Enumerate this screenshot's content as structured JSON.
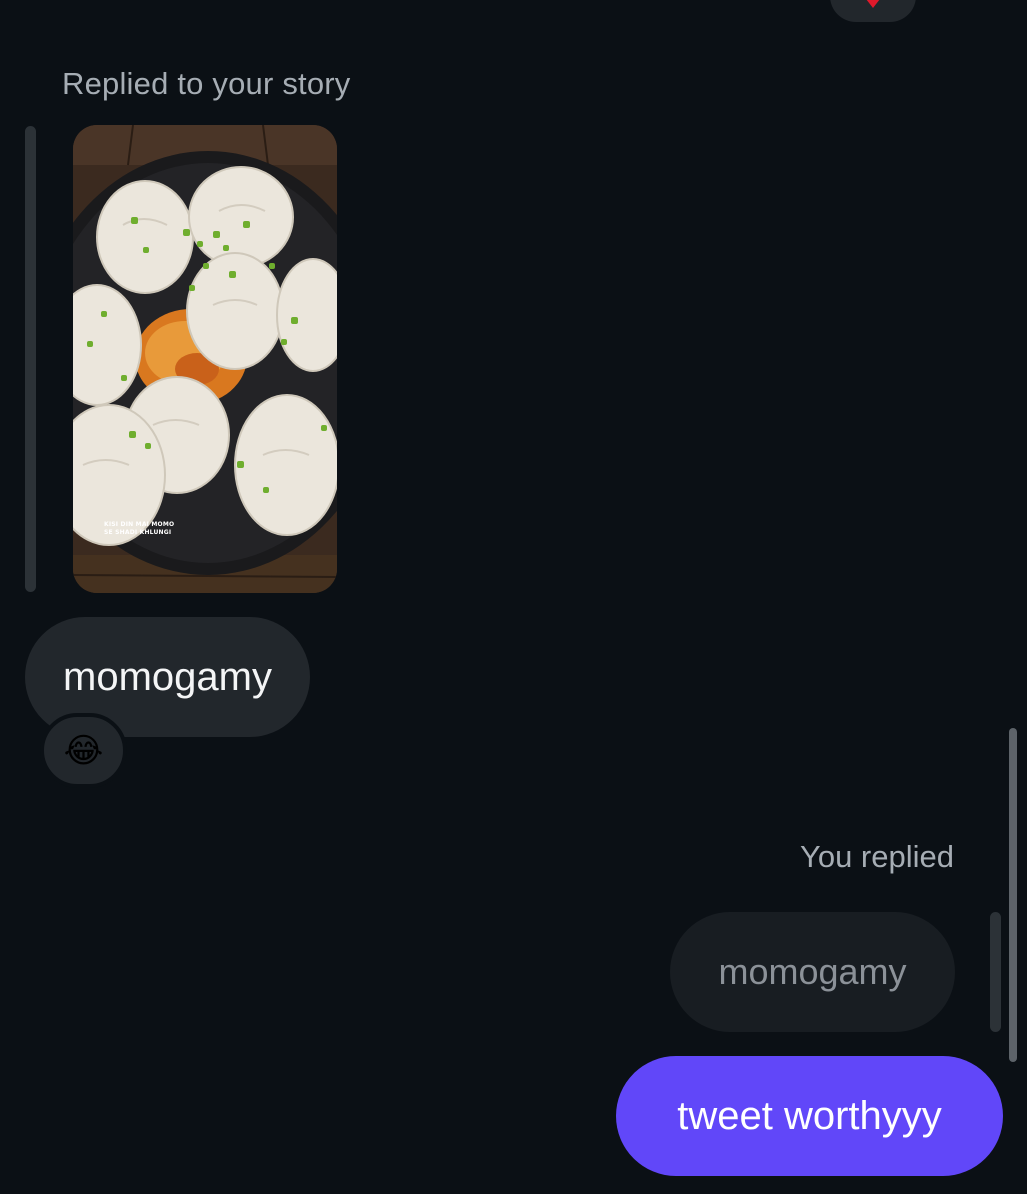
{
  "conversation": {
    "story_reply_caption": "Replied to your story",
    "story_overlay_text": [
      "KISI DIN MAI MOMO",
      "SE SHADI KHLUNGI"
    ],
    "incoming_message": "momogamy",
    "incoming_reaction": "😂",
    "you_replied_caption": "You replied",
    "quoted_message": "momogamy",
    "outgoing_message": "tweet worthyyy"
  },
  "colors": {
    "background": "#0b1015",
    "incoming_bubble": "#22272c",
    "outgoing_bubble": "#6147f9",
    "reaction_heart": "#e0192b"
  },
  "icons": {
    "top_reaction": "heart-icon"
  }
}
